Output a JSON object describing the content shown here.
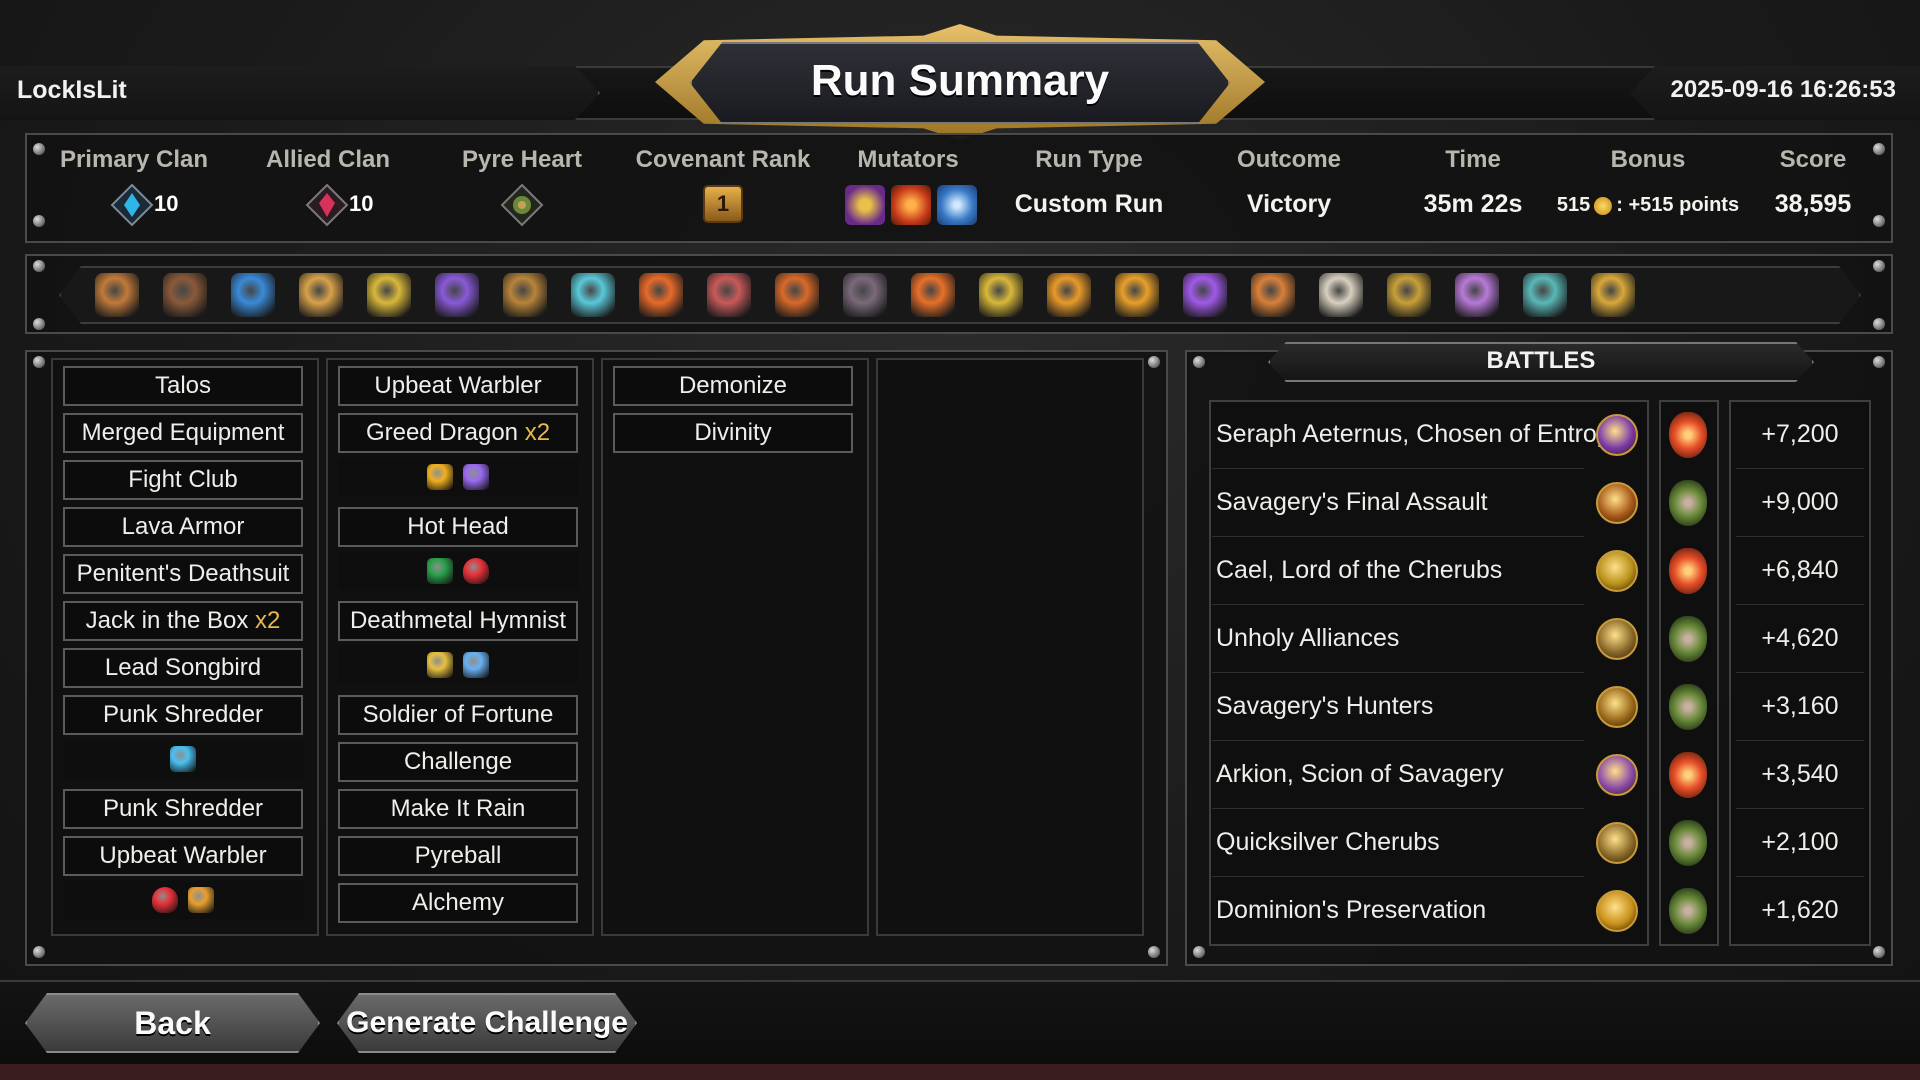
{
  "header": {
    "player_name": "LockIsLit",
    "title": "Run Summary",
    "datetime": "2025-09-16 16:26:53"
  },
  "stats": {
    "primary_clan": {
      "label": "Primary Clan",
      "level": "10",
      "icon": "clan-crystal-icon",
      "color": "#2fb6e8"
    },
    "allied_clan": {
      "label": "Allied Clan",
      "level": "10",
      "icon": "clan-demon-icon",
      "color": "#d8325a"
    },
    "pyre_heart": {
      "label": "Pyre Heart",
      "icon": "pyre-heart-icon"
    },
    "covenant_rank": {
      "label": "Covenant Rank",
      "value": "1"
    },
    "mutators": {
      "label": "Mutators",
      "icons": [
        "mutator-orbs-icon",
        "mutator-fire-icon",
        "mutator-swirl-icon"
      ]
    },
    "run_type": {
      "label": "Run Type",
      "value": "Custom Run"
    },
    "outcome": {
      "label": "Outcome",
      "value": "Victory"
    },
    "time": {
      "label": "Time",
      "value": "35m 22s"
    },
    "bonus": {
      "label": "Bonus",
      "amount": "515",
      "points": ": +515 points"
    },
    "score": {
      "label": "Score",
      "value": "38,595"
    }
  },
  "artifacts": [
    {
      "icon": "pistol-artifact-icon",
      "color": "#c07a3a"
    },
    {
      "icon": "hammer-artifact-icon",
      "color": "#8a5a3a"
    },
    {
      "icon": "blue-blade-artifact-icon",
      "color": "#3a8ad8"
    },
    {
      "icon": "lantern-artifact-icon",
      "color": "#d8a24a"
    },
    {
      "icon": "golden-staff-artifact-icon",
      "color": "#d8b83a"
    },
    {
      "icon": "purple-crystal-artifact-icon",
      "color": "#8a5ad8"
    },
    {
      "icon": "ring-artifact-icon",
      "color": "#b8843a"
    },
    {
      "icon": "lightning-cloud-artifact-icon",
      "color": "#5ac8d8"
    },
    {
      "icon": "fire-orb-artifact-icon",
      "color": "#e86a2a"
    },
    {
      "icon": "maw-artifact-icon",
      "color": "#c85a5a"
    },
    {
      "icon": "demon-skull-artifact-icon",
      "color": "#d86a2a"
    },
    {
      "icon": "potion-artifact-icon",
      "color": "#7a6a7a"
    },
    {
      "icon": "scroll-artifact-icon",
      "color": "#e8702a"
    },
    {
      "icon": "crown-artifact-icon",
      "color": "#d8b83a"
    },
    {
      "icon": "card-artifact-icon",
      "color": "#e89a2a"
    },
    {
      "icon": "sun-coin-artifact-icon",
      "color": "#e8a02a"
    },
    {
      "icon": "purple-flame-artifact-icon",
      "color": "#a05ae8"
    },
    {
      "icon": "claw-artifact-icon",
      "color": "#d8803a"
    },
    {
      "icon": "feather-artifact-icon",
      "color": "#d8d0c0"
    },
    {
      "icon": "spear-artifact-icon",
      "color": "#c8a03a"
    },
    {
      "icon": "shard-artifact-icon",
      "color": "#b87ad8"
    },
    {
      "icon": "totem-artifact-icon",
      "color": "#5ab8b8"
    },
    {
      "icon": "golden-idol-artifact-icon",
      "color": "#d8a83a"
    }
  ],
  "deck": {
    "col1": [
      {
        "name": "Talos"
      },
      {
        "name": "Merged Equipment"
      },
      {
        "name": "Fight Club"
      },
      {
        "name": "Lava Armor"
      },
      {
        "name": "Penitent's Deathsuit"
      },
      {
        "name": "Jack in the Box",
        "qty": "x2"
      },
      {
        "name": "Lead Songbird"
      },
      {
        "name": "Punk Shredder",
        "upgrades": [
          "blue-crystal-upgrade-icon"
        ]
      },
      {
        "name": "Punk Shredder"
      },
      {
        "name": "Upbeat Warbler",
        "upgrades": [
          "heart-upgrade-icon",
          "boot-upgrade-icon"
        ]
      }
    ],
    "col2": [
      {
        "name": "Upbeat Warbler"
      },
      {
        "name": "Greed Dragon",
        "qty": "x2",
        "upgrades": [
          "gold-gem-upgrade-icon",
          "purple-gem-upgrade-icon"
        ]
      },
      {
        "name": "Hot Head",
        "upgrades": [
          "green-shield-upgrade-icon",
          "heart-upgrade-icon"
        ]
      },
      {
        "name": "Deathmetal Hymnist",
        "upgrades": [
          "gold-crown-upgrade-icon",
          "crossed-swords-upgrade-icon"
        ]
      },
      {
        "name": "Soldier of Fortune"
      },
      {
        "name": "Challenge"
      },
      {
        "name": "Make It Rain"
      },
      {
        "name": "Pyreball"
      },
      {
        "name": "Alchemy"
      }
    ],
    "col3": [
      {
        "name": "Demonize"
      },
      {
        "name": "Divinity"
      }
    ]
  },
  "battles": {
    "title": "BATTLES",
    "rows": [
      {
        "name": "Seraph Aeternus, Chosen of Entropy",
        "icon": "seraph-boss-icon",
        "heart": "pyre-heart-red-icon",
        "score": "+7,200"
      },
      {
        "name": "Savagery's Final Assault",
        "icon": "savagery-icon",
        "heart": "pyre-heart-green-icon",
        "score": "+9,000"
      },
      {
        "name": "Cael, Lord of the Cherubs",
        "icon": "cael-boss-icon",
        "heart": "pyre-heart-red-icon",
        "score": "+6,840"
      },
      {
        "name": "Unholy Alliances",
        "icon": "alliance-icon",
        "heart": "pyre-heart-green-icon",
        "score": "+4,620"
      },
      {
        "name": "Savagery's Hunters",
        "icon": "hunters-icon",
        "heart": "pyre-heart-green-icon",
        "score": "+3,160"
      },
      {
        "name": "Arkion, Scion of Savagery",
        "icon": "arkion-boss-icon",
        "heart": "pyre-heart-red-icon",
        "score": "+3,540"
      },
      {
        "name": "Quicksilver Cherubs",
        "icon": "cherubs-icon",
        "heart": "pyre-heart-green-icon",
        "score": "+2,100"
      },
      {
        "name": "Dominion's Preservation",
        "icon": "honeycomb-icon",
        "heart": "pyre-heart-green-icon",
        "score": "+1,620"
      }
    ]
  },
  "footer": {
    "back_label": "Back",
    "generate_label": "Generate Challenge"
  }
}
